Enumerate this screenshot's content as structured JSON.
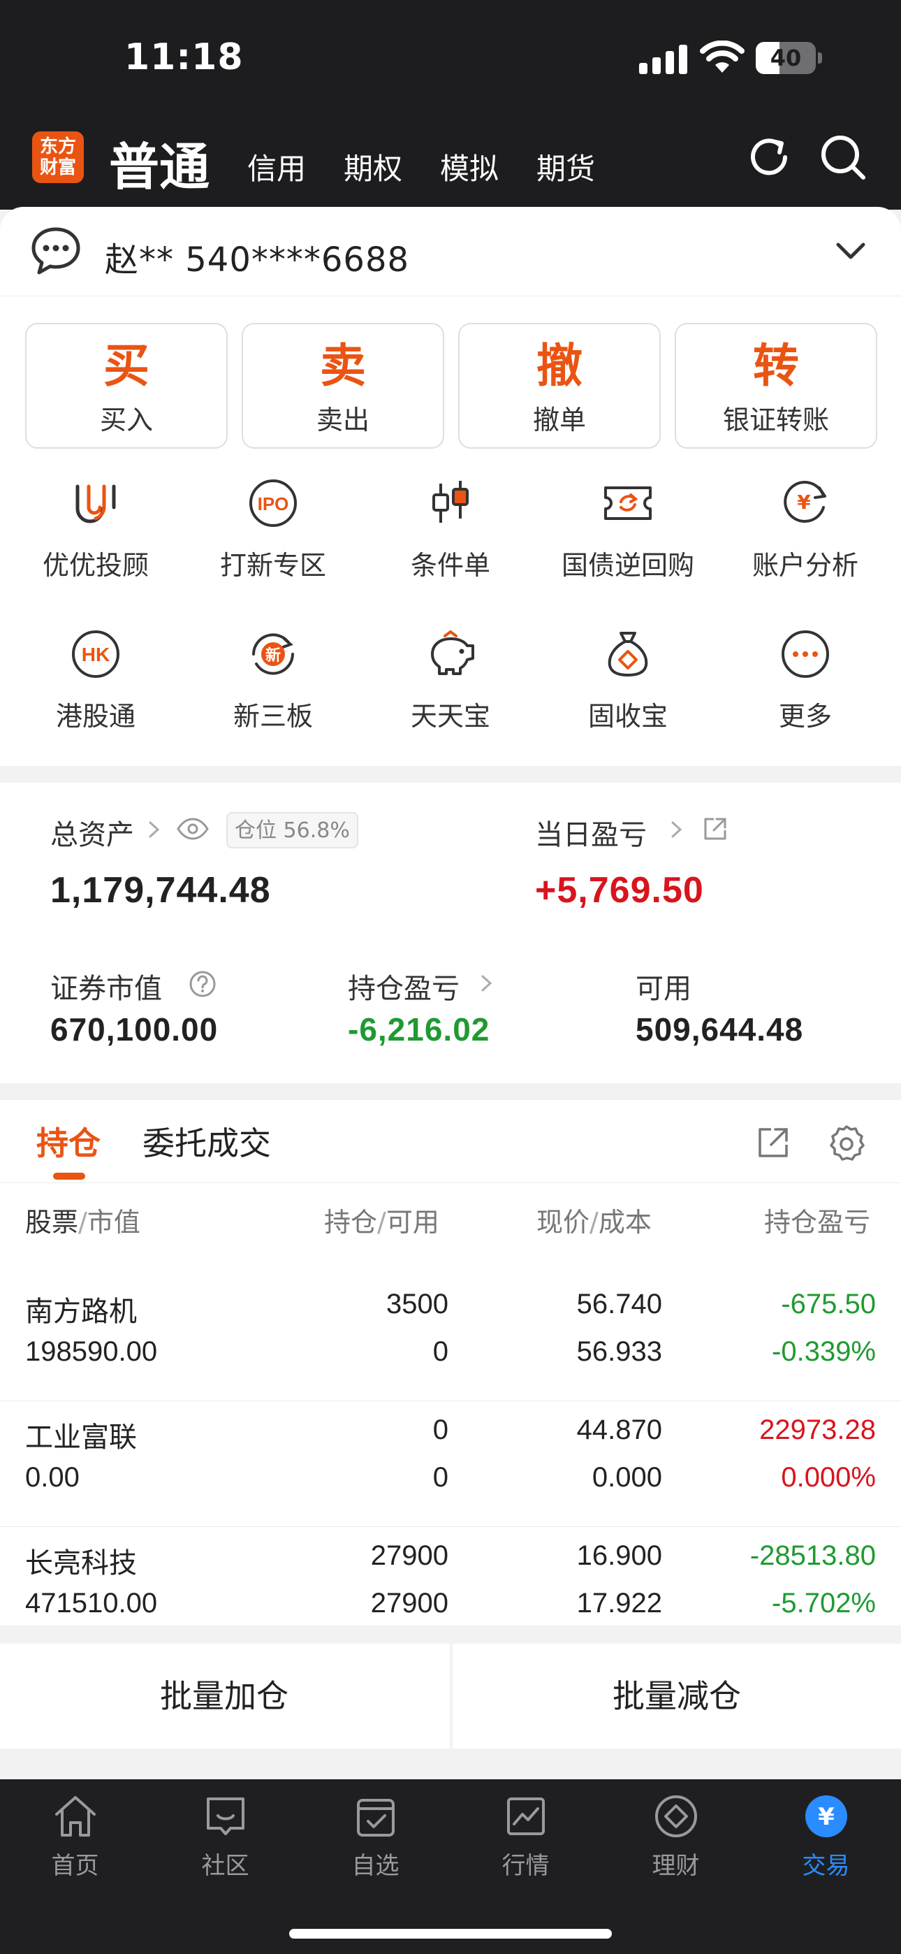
{
  "status_bar": {
    "time": "11:18",
    "battery": "40",
    "battery_level": 0.4
  },
  "header": {
    "logo_text": "东方\n财富",
    "mode_main": "普通",
    "mode_tabs": [
      "信用",
      "期权",
      "模拟",
      "期货"
    ],
    "icons": [
      "refresh-icon",
      "search-icon"
    ]
  },
  "account": {
    "text": "赵** 540****6688"
  },
  "main_actions": [
    {
      "glyph": "买",
      "label": "买入"
    },
    {
      "glyph": "卖",
      "label": "卖出"
    },
    {
      "glyph": "撤",
      "label": "撤单"
    },
    {
      "glyph": "转",
      "label": "银证转账"
    }
  ],
  "shortcuts": [
    {
      "label": "优优投顾",
      "icon": "uu-advisor-icon"
    },
    {
      "label": "打新专区",
      "icon": "ipo-icon"
    },
    {
      "label": "条件单",
      "icon": "candlestick-icon"
    },
    {
      "label": "国债逆回购",
      "icon": "repo-icon"
    },
    {
      "label": "账户分析",
      "icon": "account-analysis-icon"
    },
    {
      "label": "港股通",
      "icon": "hk-icon"
    },
    {
      "label": "新三板",
      "icon": "new-board-icon"
    },
    {
      "label": "天天宝",
      "icon": "piggy-bank-icon"
    },
    {
      "label": "固收宝",
      "icon": "money-bag-icon"
    },
    {
      "label": "更多",
      "icon": "more-icon"
    }
  ],
  "assets": {
    "total_label": "总资产",
    "position_badge": "仓位 56.8%",
    "total_value": "1,179,744.48",
    "daily_pl_label": "当日盈亏",
    "daily_pl_value": "+5,769.50",
    "securities_label": "证券市值",
    "securities_value": "670,100.00",
    "holding_pl_label": "持仓盈亏",
    "holding_pl_value": "-6,216.02",
    "available_label": "可用",
    "available_value": "509,644.48"
  },
  "holdings": {
    "tabs": [
      "持仓",
      "委托成交"
    ],
    "headers": {
      "stock": "股票",
      "value": "市值",
      "position": "持仓",
      "available": "可用",
      "price": "现价",
      "cost": "成本",
      "pl": "持仓盈亏"
    },
    "rows": [
      {
        "name": "南方路机",
        "market_value": "198590.00",
        "position": "3500",
        "available": "0",
        "price": "56.740",
        "cost": "56.933",
        "pl": "-675.50",
        "pl_pct": "-0.339%",
        "trend": "down"
      },
      {
        "name": "工业富联",
        "market_value": "0.00",
        "position": "0",
        "available": "0",
        "price": "44.870",
        "cost": "0.000",
        "pl": "22973.28",
        "pl_pct": "0.000%",
        "trend": "up"
      },
      {
        "name": "长亮科技",
        "market_value": "471510.00",
        "position": "27900",
        "available": "27900",
        "price": "16.900",
        "cost": "17.922",
        "pl": "-28513.80",
        "pl_pct": "-5.702%",
        "trend": "down"
      }
    ],
    "batch_add": "批量加仓",
    "batch_reduce": "批量减仓"
  },
  "tabbar": [
    {
      "label": "首页",
      "icon": "home-icon"
    },
    {
      "label": "社区",
      "icon": "community-icon"
    },
    {
      "label": "自选",
      "icon": "watchlist-icon"
    },
    {
      "label": "行情",
      "icon": "market-icon"
    },
    {
      "label": "理财",
      "icon": "wealth-icon"
    },
    {
      "label": "交易",
      "icon": "trade-icon",
      "active": true
    }
  ],
  "colors": {
    "accent": "#ea5413",
    "up": "#d8141e",
    "down": "#1f9a31",
    "active_tab": "#2a8cff"
  }
}
